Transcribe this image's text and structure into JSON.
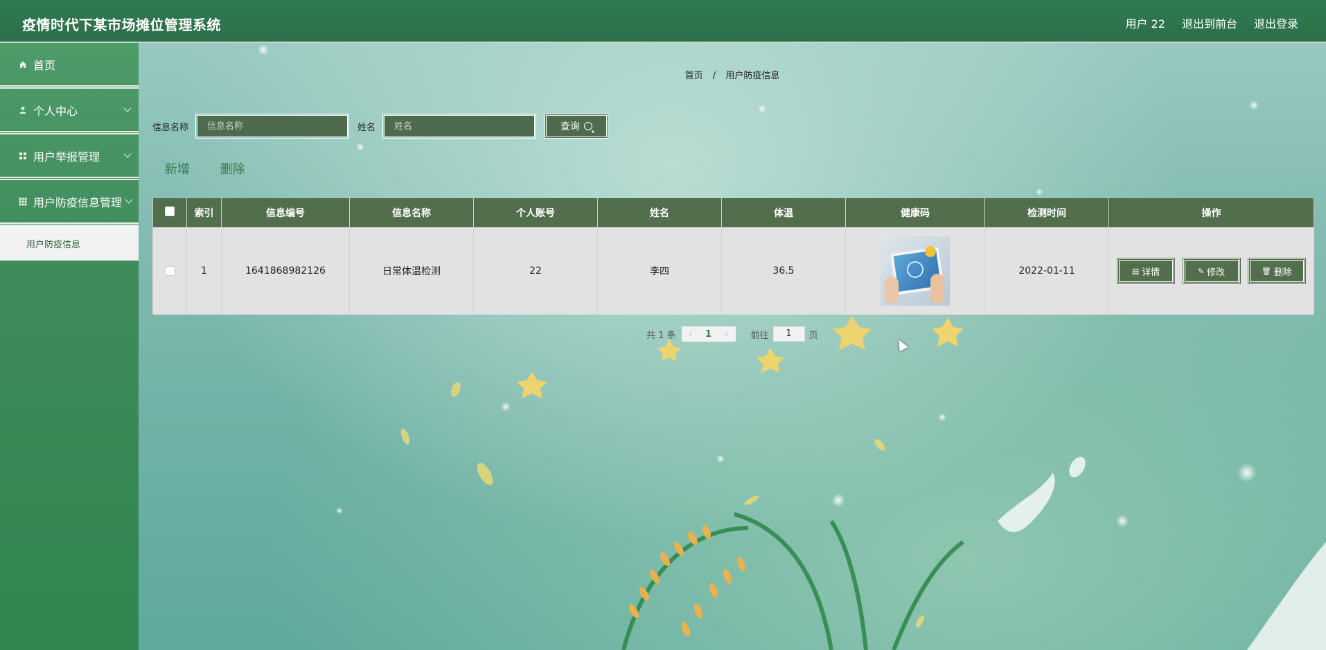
{
  "header": {
    "title": "疫情时代下某市场摊位管理系统",
    "user": "用户 22",
    "to_front": "退出到前台",
    "logout": "退出登录"
  },
  "sidebar": {
    "items": [
      {
        "label": "首页",
        "icon": "home-icon"
      },
      {
        "label": "个人中心",
        "icon": "user-icon"
      },
      {
        "label": "用户举报管理",
        "icon": "grid-icon"
      },
      {
        "label": "用户防疫信息管理",
        "icon": "grid-icon"
      }
    ],
    "submenu": [
      "用户防疫信息"
    ]
  },
  "breadcrumb": {
    "home": "首页",
    "sep": "/",
    "current": "用户防疫信息"
  },
  "search": {
    "info_label": "信息名称",
    "info_placeholder": "信息名称",
    "name_label": "姓名",
    "name_placeholder": "姓名",
    "query_label": "查询"
  },
  "actions": {
    "add": "新增",
    "delete": "删除"
  },
  "table": {
    "headers": [
      "索引",
      "信息编号",
      "信息名称",
      "个人账号",
      "姓名",
      "体温",
      "健康码",
      "检测时间",
      "操作"
    ],
    "rows": [
      {
        "index": "1",
        "code": "1641868982126",
        "name": "日常体温检测",
        "account": "22",
        "person": "李四",
        "temp": "36.5",
        "check_time": "2022-01-11",
        "ops": {
          "detail": "详情",
          "edit": "修改",
          "delete": "删除"
        }
      }
    ]
  },
  "pagination": {
    "total": "共 1 条",
    "current": "1",
    "goto_label": "前往",
    "goto_value": "1",
    "page_unit": "页"
  },
  "colors": {
    "header_green": "#2f7a50",
    "table_header": "#526e4c",
    "accent_text": "#3b7a52"
  }
}
